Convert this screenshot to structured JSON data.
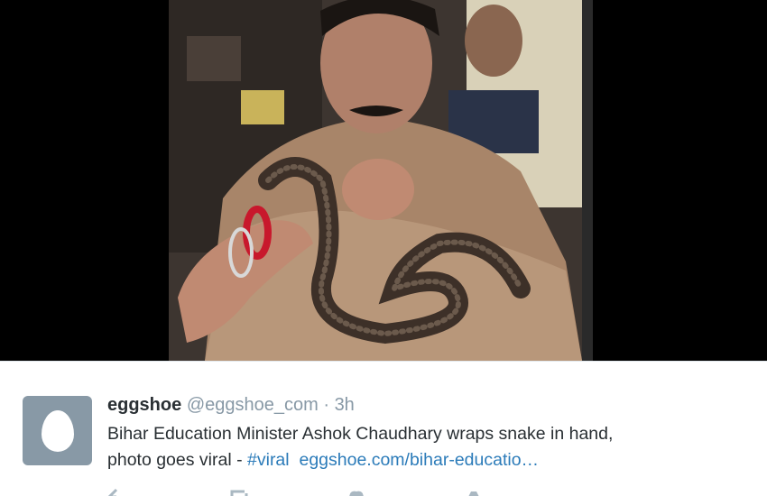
{
  "tweet": {
    "display_name": "eggshoe",
    "handle": "@eggshoe_com",
    "separator": "·",
    "time": "3h",
    "text_line1": "Bihar Education Minister Ashok Chaudhary wraps snake in hand,",
    "text_line2_prefix": "photo goes viral - ",
    "hashtag": "#viral",
    "url": "eggshoe.com/bihar-educatio…"
  },
  "icons": {
    "avatar": "default-egg-avatar",
    "actions": [
      "reply-icon",
      "retweet-icon",
      "like-icon",
      "more-icon"
    ]
  },
  "colors": {
    "name": "#292f33",
    "muted": "#8899a6",
    "link": "#2b7bb9",
    "avatar_bg": "#8899a6",
    "media_bg": "#000000"
  }
}
